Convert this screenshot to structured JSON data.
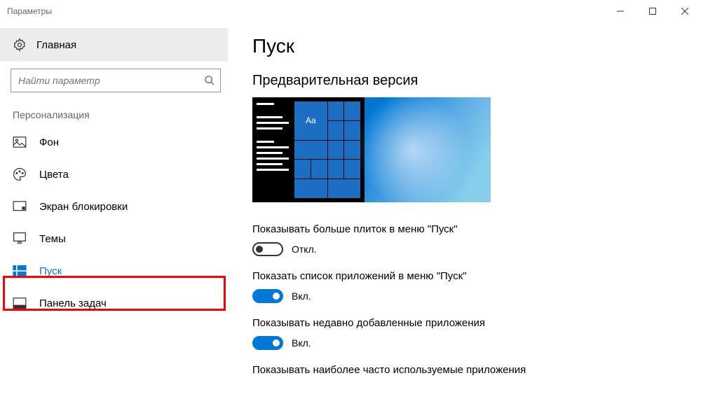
{
  "window": {
    "title": "Параметры"
  },
  "sidebar": {
    "home": "Главная",
    "search_placeholder": "Найти параметр",
    "section": "Персонализация",
    "items": [
      {
        "label": "Фон"
      },
      {
        "label": "Цвета"
      },
      {
        "label": "Экран блокировки"
      },
      {
        "label": "Темы"
      },
      {
        "label": "Пуск"
      },
      {
        "label": "Панель задач"
      }
    ]
  },
  "page": {
    "title": "Пуск",
    "preview_heading": "Предварительная версия",
    "preview_tile_text": "Aa",
    "settings": [
      {
        "label": "Показывать больше плиток в меню \"Пуск\"",
        "on": false,
        "state": "Откл."
      },
      {
        "label": "Показать список приложений в меню \"Пуск\"",
        "on": true,
        "state": "Вкл."
      },
      {
        "label": "Показывать недавно добавленные приложения",
        "on": true,
        "state": "Вкл."
      },
      {
        "label": "Показывать наиболее часто используемые приложения",
        "on": null,
        "state": ""
      }
    ]
  }
}
